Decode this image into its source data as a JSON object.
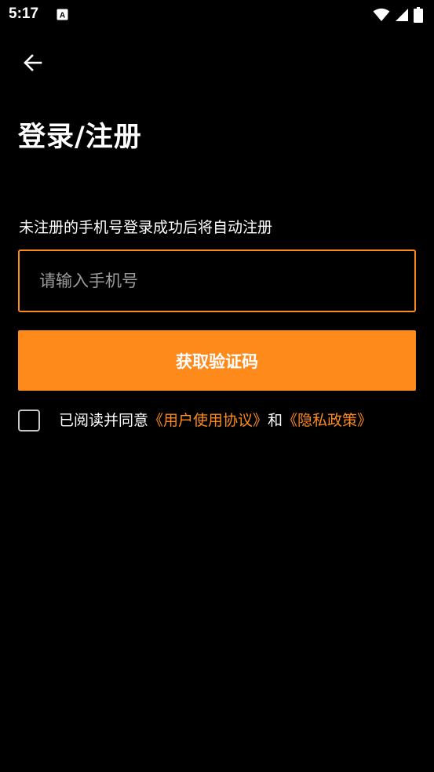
{
  "status_bar": {
    "time": "5:17",
    "app_icon_letter": "A"
  },
  "header": {
    "back_icon": "arrow-left-icon",
    "title": "登录/注册"
  },
  "form": {
    "hint": "未注册的手机号登录成功后将自动注册",
    "phone_placeholder": "请输入手机号",
    "phone_value": "",
    "submit_label": "获取验证码"
  },
  "agreement": {
    "checked": false,
    "prefix": "已阅读并同意",
    "user_agreement": "《用户使用协议》",
    "conjunction": "和",
    "privacy_policy": "《隐私政策》"
  },
  "colors": {
    "accent": "#ff8a1c",
    "background": "#000000",
    "placeholder": "#9c9c9c"
  }
}
